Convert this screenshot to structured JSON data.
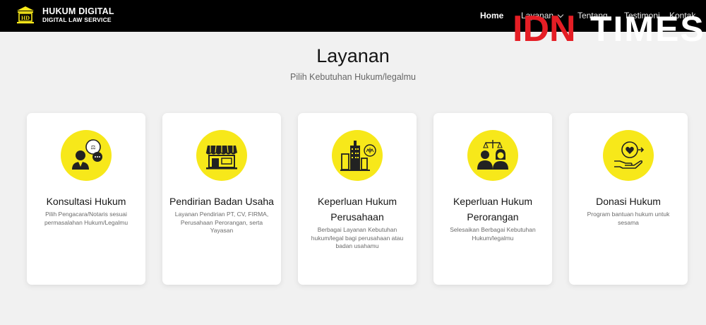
{
  "brand": {
    "logo_icon": "hd-building-logo-icon",
    "name": "HUKUM DIGITAL",
    "tagline": "DIGITAL LAW SERVICE"
  },
  "nav": {
    "home": "Home",
    "layanan": "Layanan",
    "tentang": "Tentang",
    "testimoni": "Testimoni",
    "kontak": "Kontak"
  },
  "watermark": {
    "idn": "IDN",
    "times": "TIMES"
  },
  "section": {
    "title": "Layanan",
    "subtitle": "Pilih Kebutuhan Hukum/legalmu"
  },
  "cards": [
    {
      "icon": "lawyer-consultation-icon",
      "title": "Konsultasi Hukum",
      "desc": "Pilih Pengacara/Notaris sesuai permasalahan Hukum/Legalmu"
    },
    {
      "icon": "storefront-icon",
      "title": "Pendirian Badan Usaha",
      "desc": "Layanan Pendirian PT, CV, FIRMA, Perusahaan Perorangan, serta Yayasan"
    },
    {
      "icon": "corporate-building-law-icon",
      "title": "Keperluan Hukum Perusahaan",
      "desc": "Berbagai Layanan Kebutuhan hukum/legal bagi perusahaan atau badan usahamu"
    },
    {
      "icon": "people-justice-scale-icon",
      "title": "Keperluan Hukum Perorangan",
      "desc": "Selesaikan Berbagai Kebutuhan Hukum/legalmu"
    },
    {
      "icon": "hand-heart-donation-icon",
      "title": "Donasi Hukum",
      "desc": "Program bantuan hukum untuk sesama"
    }
  ],
  "colors": {
    "navbar": "#000000",
    "accent_yellow": "#f7e81a",
    "watermark_red": "#e51e25",
    "page_bg": "#f1f1f1"
  }
}
